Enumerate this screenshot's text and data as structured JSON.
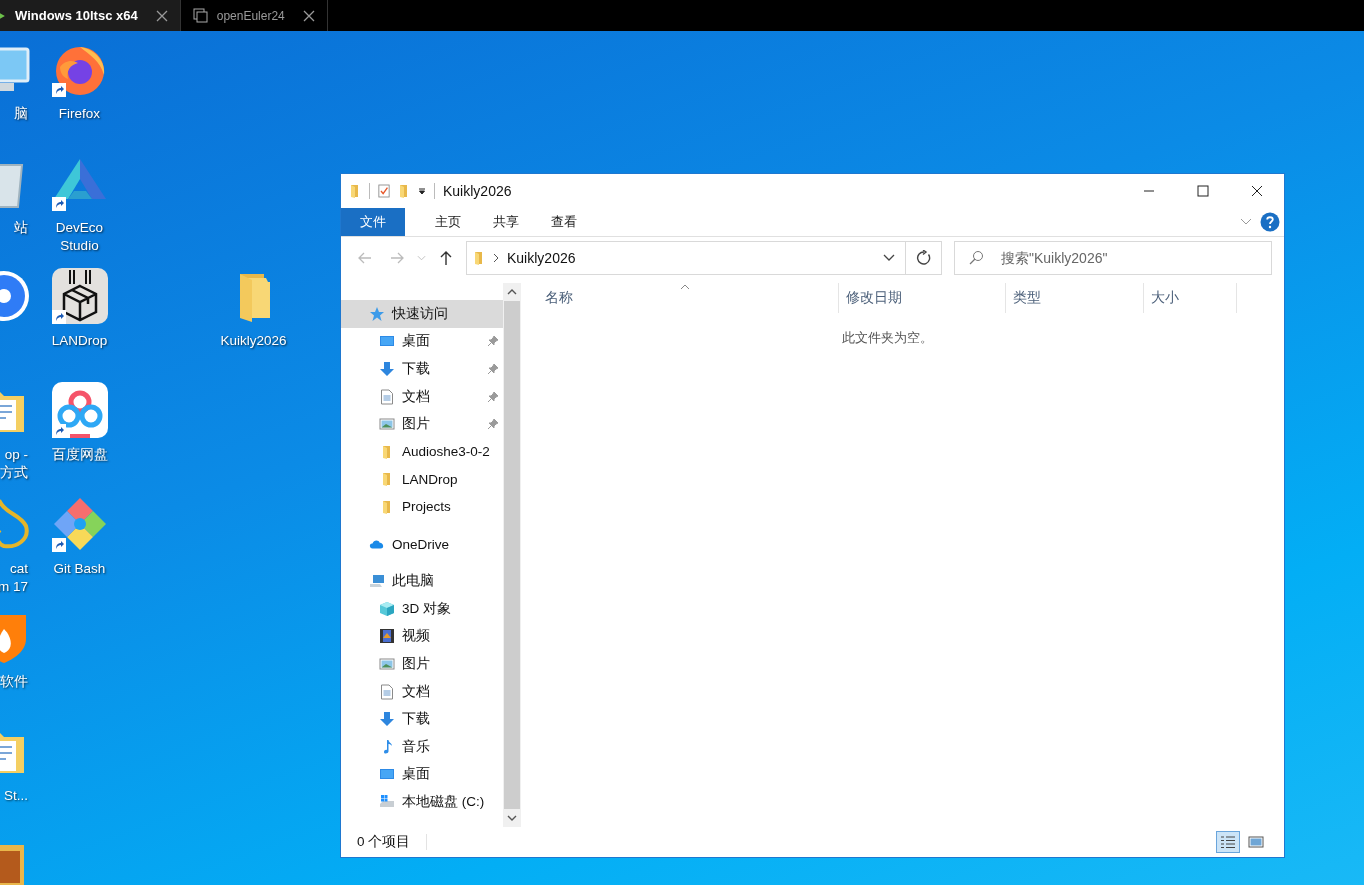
{
  "vm_tabs": [
    {
      "label": "Windows 10ltsc x64",
      "selected": true
    },
    {
      "label": "openEuler24",
      "selected": false
    }
  ],
  "desktop_columns": [
    [
      {
        "kind": "monitor",
        "lines": [
          "脑"
        ]
      },
      {
        "kind": "recycle",
        "lines": [
          "站"
        ]
      },
      {
        "kind": "disc"
      },
      {
        "kind": "document",
        "lines": [
          "op -",
          "方式"
        ]
      },
      {
        "kind": "tomcat",
        "lines": [
          "cat",
          "m 17"
        ]
      },
      {
        "kind": "shield",
        "lines": [
          "软件"
        ]
      },
      {
        "kind": "document",
        "lines": [
          "St..."
        ]
      },
      {
        "kind": "archive"
      }
    ],
    [
      {
        "kind": "firefox",
        "lines": [
          "Firefox"
        ],
        "shortcut": true
      },
      {
        "kind": "deveco",
        "lines": [
          "DevEco",
          "Studio"
        ],
        "shortcut": true
      },
      {
        "kind": "landrop",
        "lines": [
          "LANDrop"
        ],
        "shortcut": true
      },
      {
        "kind": "baidu",
        "lines": [
          "百度网盘"
        ],
        "shortcut": true
      },
      {
        "kind": "git",
        "lines": [
          "Git Bash"
        ],
        "shortcut": true
      }
    ],
    [
      null,
      null,
      {
        "kind": "folder",
        "lines": [
          "Kuikly2026"
        ],
        "shortcut": false
      }
    ]
  ],
  "explorer": {
    "title": "Kuikly2026",
    "ribbon_tabs": [
      {
        "label": "文件",
        "selected": true
      },
      {
        "label": "主页",
        "selected": false
      },
      {
        "label": "共享",
        "selected": false
      },
      {
        "label": "查看",
        "selected": false
      }
    ],
    "address": {
      "path": "Kuikly2026"
    },
    "search": {
      "placeholder": "搜索\"Kuikly2026\""
    },
    "nav": [
      {
        "label": "快速访问",
        "kind": "star",
        "selected": true,
        "children": [
          {
            "label": "桌面",
            "kind": "desktop",
            "pinned": true,
            "selected": false
          },
          {
            "label": "下载",
            "kind": "download",
            "pinned": true,
            "selected": false
          },
          {
            "label": "文档",
            "kind": "document",
            "pinned": true,
            "selected": false
          },
          {
            "label": "图片",
            "kind": "picture",
            "pinned": true,
            "selected": false
          },
          {
            "label": "Audioshe3-0-2",
            "kind": "folder",
            "pinned": false,
            "selected": false
          },
          {
            "label": "LANDrop",
            "kind": "folder",
            "pinned": false,
            "selected": false
          },
          {
            "label": "Projects",
            "kind": "folder",
            "pinned": false,
            "selected": false
          }
        ]
      },
      {
        "label": "OneDrive",
        "kind": "cloud",
        "selected": false
      },
      {
        "label": "此电脑",
        "kind": "pc",
        "selected": false,
        "children": [
          {
            "label": "3D 对象",
            "kind": "cube",
            "pinned": false,
            "selected": false
          },
          {
            "label": "视频",
            "kind": "video",
            "pinned": false,
            "selected": false
          },
          {
            "label": "图片",
            "kind": "picture",
            "pinned": false,
            "selected": false
          },
          {
            "label": "文档",
            "kind": "document",
            "pinned": false,
            "selected": false
          },
          {
            "label": "下载",
            "kind": "download",
            "pinned": false,
            "selected": false
          },
          {
            "label": "音乐",
            "kind": "music",
            "pinned": false,
            "selected": false
          },
          {
            "label": "桌面",
            "kind": "desktop",
            "pinned": false,
            "selected": false
          },
          {
            "label": "本地磁盘 (C:)",
            "kind": "drive",
            "pinned": false,
            "selected": false
          }
        ]
      }
    ],
    "columns": [
      {
        "label": "名称",
        "sorted": true
      },
      {
        "label": "修改日期",
        "sorted": false
      },
      {
        "label": "类型",
        "sorted": false
      },
      {
        "label": "大小",
        "sorted": false
      }
    ],
    "empty_message": "此文件夹为空。",
    "status": "0 个项目",
    "views": [
      {
        "kind": "details",
        "selected": true
      },
      {
        "kind": "large_icons",
        "selected": false
      }
    ]
  }
}
